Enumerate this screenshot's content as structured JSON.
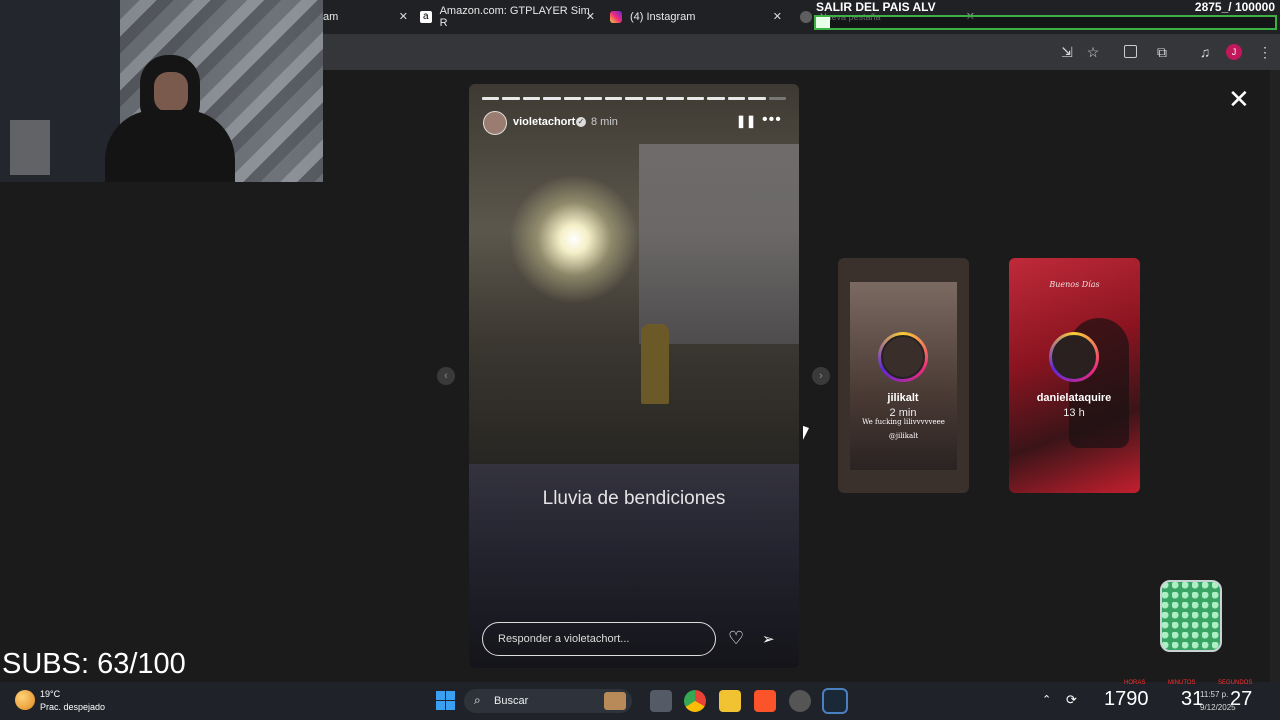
{
  "browser": {
    "tabs": [
      {
        "label": "am"
      },
      {
        "label": "Amazon.com: GTPLAYER Sim R"
      },
      {
        "label": "(4) Instagram"
      },
      {
        "label": "Nueva pestaña"
      }
    ]
  },
  "overlay": {
    "goal_title": "SALIR DEL PAIS ALV",
    "goal_count": "2875_/ 100000",
    "subs": "SUBS: 63/100",
    "bottom_counters": [
      "1790",
      "31",
      "27"
    ],
    "counter_labels": [
      "HORAS",
      "MINUTOS",
      "SEGUNDOS"
    ]
  },
  "story": {
    "username": "violetachort",
    "time": "8 min",
    "caption": "Lluvia de bendiciones",
    "reply_placeholder": "Responder a violetachort..."
  },
  "side_stories": [
    {
      "username": "jilikalt",
      "time": "2 min",
      "overlay_text": "We fucking lilivvvvveee",
      "tag": "@jilikalt"
    },
    {
      "username": "danielataquire",
      "time": "13 h",
      "overlay_text": "Buenos Días"
    }
  ],
  "taskbar": {
    "weather_temp": "19°C",
    "weather_desc": "Prac. despejado",
    "search_label": "Buscar",
    "clock_time": "11:57 p.",
    "clock_date": "9/12/2025"
  },
  "colors": {
    "instagram_gradient": [
      "#f9ce34",
      "#ee2a7b",
      "#6228d7"
    ],
    "goal_bar": "#3cb043"
  }
}
